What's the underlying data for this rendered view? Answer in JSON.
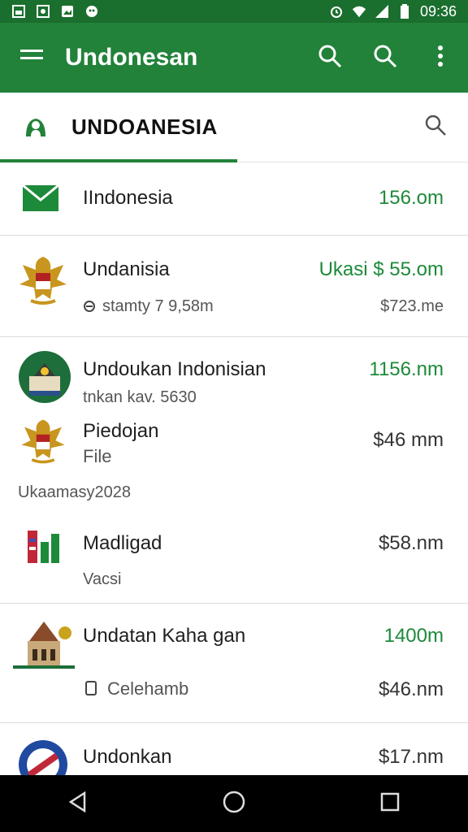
{
  "status_bar": {
    "time": "09:36"
  },
  "app_bar": {
    "title": "Undonesan",
    "icons": [
      "menu-icon",
      "search-icon",
      "search-icon",
      "more-vert-icon"
    ]
  },
  "tab": {
    "label": "UNDOANESIA"
  },
  "items": [
    {
      "title": "IIndonesia",
      "amount": "156.om"
    },
    {
      "title": "Undanisia",
      "amount": "Ukasi $ 55.om",
      "sub": "stamty 7 9,58m",
      "sub_amount": "$723.me"
    },
    {
      "title": "Undoukan Indonisian",
      "amount": "1156.nm",
      "sub": "tnkan kav. 5630"
    },
    {
      "title": "Piedojan",
      "sub": "File",
      "amount": "$46 mm",
      "group_label": "Ukaamasy2028"
    },
    {
      "title": "Madligad",
      "amount": "$58.nm",
      "sub": "Vacsi"
    },
    {
      "title": "Undatan Kaha gan",
      "amount": "1400m",
      "sub": "Celehamb",
      "sub_amount": "$46.nm"
    },
    {
      "title": "Undonkan",
      "amount": "$17.nm"
    }
  ],
  "colors": {
    "primary": "#22823a",
    "primary_dark": "#1b6f2e",
    "amount_green": "#1d8a3a"
  }
}
